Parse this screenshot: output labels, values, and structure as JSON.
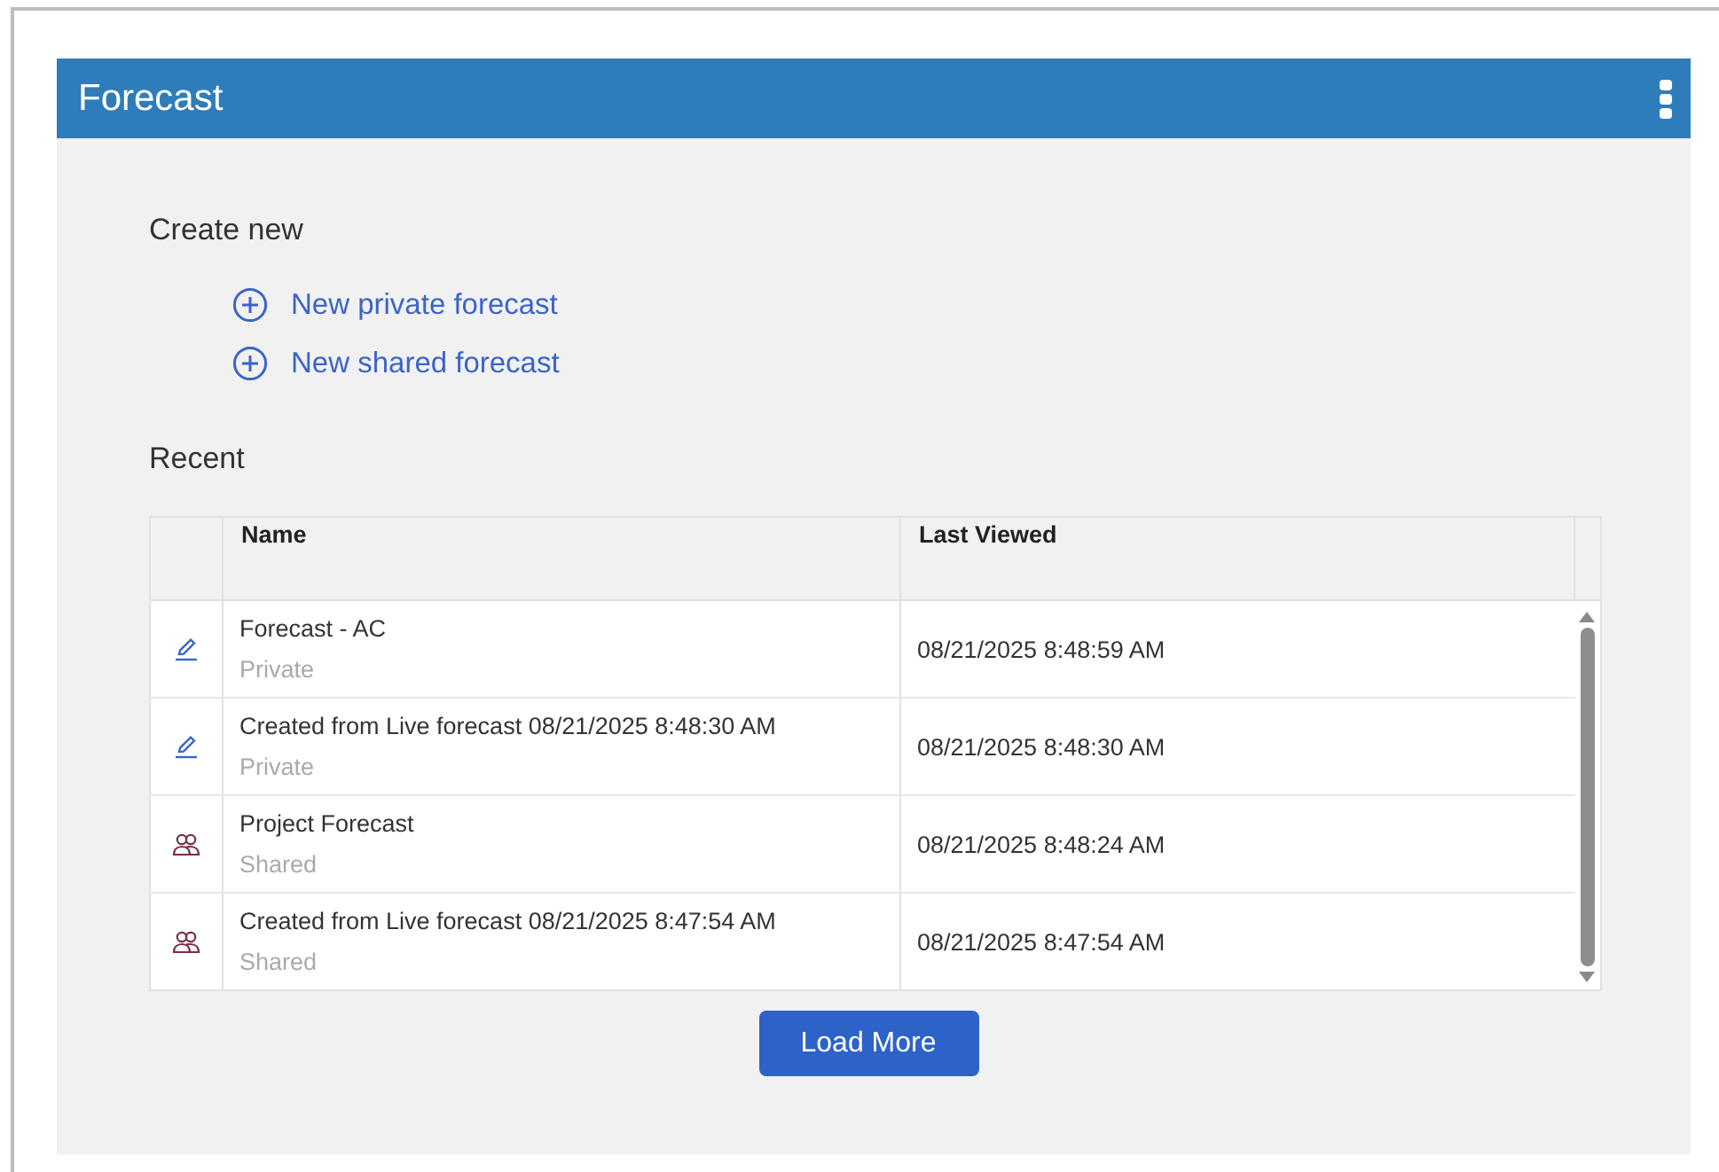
{
  "window": {
    "title": "Forecast"
  },
  "create_new": {
    "heading": "Create new",
    "actions": [
      {
        "label": "New private forecast"
      },
      {
        "label": "New shared forecast"
      }
    ]
  },
  "recent": {
    "heading": "Recent",
    "columns": [
      "Name",
      "Last Viewed"
    ],
    "rows": [
      {
        "kind": "private",
        "name": "Forecast - AC",
        "visibility": "Private",
        "last_viewed": "08/21/2025 8:48:59 AM"
      },
      {
        "kind": "private",
        "name": "Created from Live forecast 08/21/2025 8:48:30 AM",
        "visibility": "Private",
        "last_viewed": "08/21/2025 8:48:30 AM"
      },
      {
        "kind": "shared",
        "name": "Project Forecast",
        "visibility": "Shared",
        "last_viewed": "08/21/2025 8:48:24 AM"
      },
      {
        "kind": "shared",
        "name": "Created from Live forecast 08/21/2025 8:47:54 AM",
        "visibility": "Shared",
        "last_viewed": "08/21/2025 8:47:54 AM"
      }
    ]
  },
  "load_more": "Load More"
}
